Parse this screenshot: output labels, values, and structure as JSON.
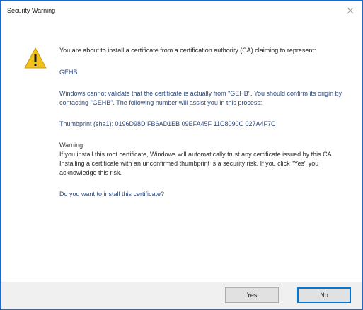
{
  "window": {
    "title": "Security Warning"
  },
  "icons": {
    "warning": "warning-icon",
    "close": "close-icon"
  },
  "colors": {
    "accent_border": "#1b6ac9",
    "warning_fill": "#f2c21b",
    "body_text": "#2f4a7a",
    "footer_bg": "#f0f0f0"
  },
  "message": {
    "intro": "You are about to install a certificate from a certification authority (CA) claiming to represent:",
    "ca_name": "GEHB",
    "validate": "Windows cannot validate that the certificate is actually from \"GEHB\". You should confirm its origin by contacting \"GEHB\". The following number will assist you in this process:",
    "thumbprint": "Thumbprint (sha1): 0196D98D FB6AD1EB 09EFA45F 11C8090C 027A4F7C",
    "warning_heading": "Warning:",
    "warning_body": "If you install this root certificate, Windows will automatically trust any certificate issued by this CA. Installing a certificate with an unconfirmed thumbprint is a security risk. If you click \"Yes\" you acknowledge this risk.",
    "question": "Do you want to install this certificate?"
  },
  "buttons": {
    "yes": "Yes",
    "no": "No"
  }
}
